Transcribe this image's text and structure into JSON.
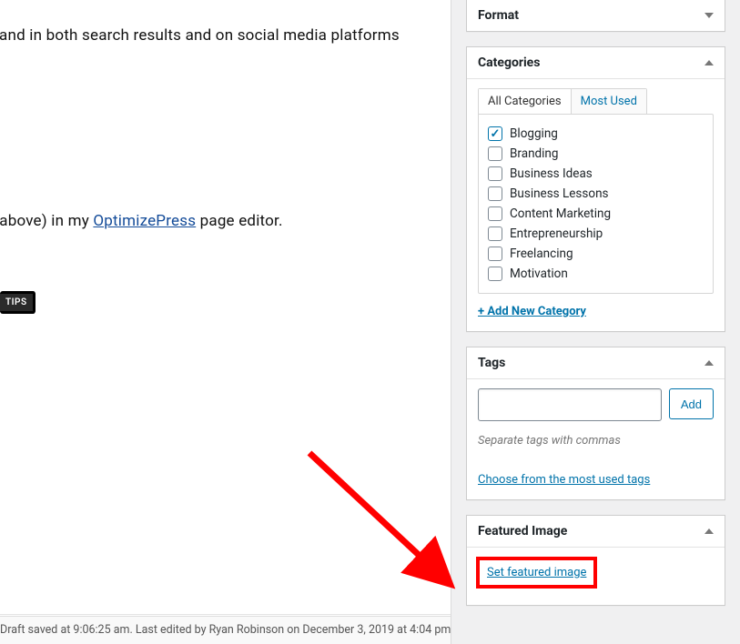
{
  "main": {
    "para1_text": "osts (and in both search results and on social media platforms",
    "para2_prefix": "nere (above) in my ",
    "para2_link": "OptimizePress",
    "para2_suffix": " page editor.",
    "tips_button": "TIPS",
    "status": "Draft saved at 9:06:25 am. Last edited by Ryan Robinson on December 3, 2019 at 4:04 pm"
  },
  "format_panel": {
    "title": "Format"
  },
  "categories_panel": {
    "title": "Categories",
    "tab_all": "All Categories",
    "tab_most": "Most Used",
    "items": [
      {
        "label": "Blogging",
        "checked": true
      },
      {
        "label": "Branding",
        "checked": false
      },
      {
        "label": "Business Ideas",
        "checked": false
      },
      {
        "label": "Business Lessons",
        "checked": false
      },
      {
        "label": "Content Marketing",
        "checked": false
      },
      {
        "label": "Entrepreneurship",
        "checked": false
      },
      {
        "label": "Freelancing",
        "checked": false
      },
      {
        "label": "Motivation",
        "checked": false
      }
    ],
    "add_new": "+ Add New Category"
  },
  "tags_panel": {
    "title": "Tags",
    "add_button": "Add",
    "hint": "Separate tags with commas",
    "choose_link": "Choose from the most used tags"
  },
  "featured_panel": {
    "title": "Featured Image",
    "link": "Set featured image"
  }
}
